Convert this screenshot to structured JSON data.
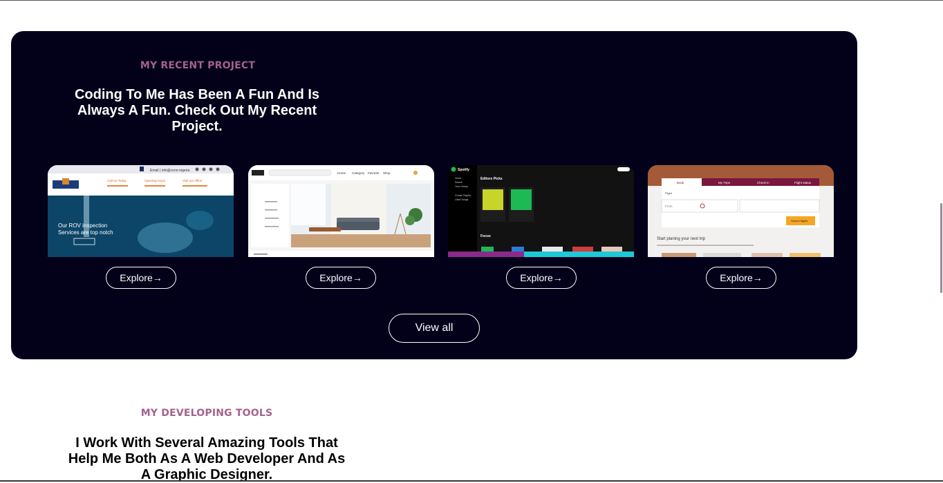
{
  "projects": {
    "label": "MY RECENT PROJECT",
    "heading": "Coding To Me Has Been A Fun And Is Always A Fun. Check Out My Recent Project.",
    "cards": [
      {
        "name": "rov-inspection-site",
        "header_text": "Email | info@conn-nigeria",
        "contacts": [
          "Call Us Today",
          "Opening Hours",
          "Visit our office"
        ],
        "hero_text": "Our ROV inspection Services are top notch",
        "explore_label": "Explore",
        "explore_icon": "arrow-right-icon"
      },
      {
        "name": "furniture-store-site",
        "nav": [
          "Home",
          "Category",
          "Favorite",
          "Shop"
        ],
        "explore_label": "Explore",
        "explore_icon": "arrow-right-icon"
      },
      {
        "name": "spotify-clone",
        "brand": "Spotify",
        "sidebar": [
          "Home",
          "Search",
          "Your Library",
          "Create Playlist",
          "Liked Songs"
        ],
        "section_title": "Editors Picks",
        "section2_title": "Focus",
        "explore_label": "Explore",
        "explore_icon": "arrow-right-icon"
      },
      {
        "name": "travel-booking-site",
        "tabs": [
          "Book",
          "My Trips",
          "Check-in",
          "Flight status"
        ],
        "trip_type": "Flight",
        "from_label": "From",
        "button": "Search flights",
        "subtitle": "Start planing your next trip",
        "explore_label": "Explore",
        "explore_icon": "arrow-right-icon"
      }
    ],
    "view_all": "View all"
  },
  "tools": {
    "label": "MY DEVELOPING TOOLS",
    "heading": "I Work With Several Amazing Tools That Help Me Both As A Web Developer And As A Graphic Designer."
  },
  "colors": {
    "section_bg": "#03001a",
    "label": "#a3628e",
    "spotify_green": "#1db954",
    "airline_maroon": "#7a1640",
    "accent_orange": "#f5a623"
  }
}
